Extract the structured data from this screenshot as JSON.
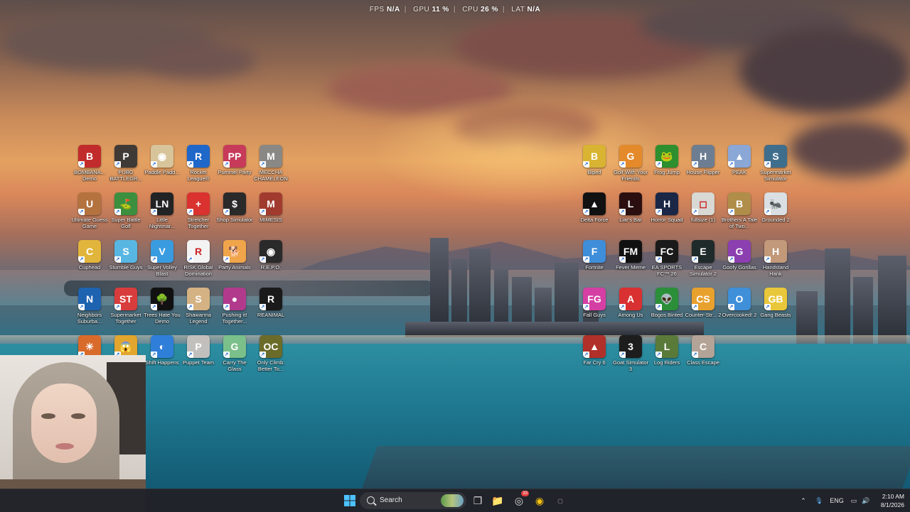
{
  "overlay": {
    "fps_label": "FPS",
    "fps_value": "N/A",
    "gpu_label": "GPU",
    "gpu_value": "11 %",
    "cpu_label": "CPU",
    "cpu_value": "26 %",
    "lat_label": "LAT",
    "lat_value": "N/A"
  },
  "desktop_left": [
    {
      "label": "BOMBANA... Demo",
      "icon": "bombana-icon",
      "color": "#c22b2b",
      "glyph": "B"
    },
    {
      "label": "PUBG BATTLEGR...",
      "icon": "pubg-icon",
      "color": "#3f3a35",
      "glyph": "P"
    },
    {
      "label": "Paddle Padd...",
      "icon": "paddle-icon",
      "color": "#d8c49a",
      "glyph": "◉"
    },
    {
      "label": "Rocket League®",
      "icon": "rocket-league-icon",
      "color": "#1f67c9",
      "glyph": "R"
    },
    {
      "label": "Pummel Party",
      "icon": "pummel-party-icon",
      "color": "#c73a59",
      "glyph": "PP"
    },
    {
      "label": "MECCHA CHAMELEON",
      "icon": "meccha-chameleon-icon",
      "color": "#8a8884",
      "glyph": "M"
    },
    {
      "label": "Ultimate Guess Game",
      "icon": "ultimate-guess-icon",
      "color": "#b3723e",
      "glyph": "U"
    },
    {
      "label": "Super Battle Golf",
      "icon": "super-battle-golf-icon",
      "color": "#3c8f3f",
      "glyph": "⛳"
    },
    {
      "label": "Little Nightmar...",
      "icon": "little-nightmares-icon",
      "color": "#222325",
      "glyph": "LN"
    },
    {
      "label": "Stretcher Together",
      "icon": "stretcher-icon",
      "color": "#d9322f",
      "glyph": "+"
    },
    {
      "label": "Shop Simulator",
      "icon": "shop-simulator-icon",
      "color": "#2a2a2a",
      "glyph": "$"
    },
    {
      "label": "MIMESIS",
      "icon": "mimesis-icon",
      "color": "#a13b2f",
      "glyph": "M"
    },
    {
      "label": "Cuphead",
      "icon": "cuphead-icon",
      "color": "#e1b53b",
      "glyph": "C"
    },
    {
      "label": "Stumble Guys",
      "icon": "stumble-guys-icon",
      "color": "#58b7e2",
      "glyph": "S"
    },
    {
      "label": "Super Volley Blast",
      "icon": "super-volley-icon",
      "color": "#3a9ce0",
      "glyph": "V"
    },
    {
      "label": "RISK Global Domination",
      "icon": "risk-icon",
      "color": "#f3f3f3",
      "glyph": "R"
    },
    {
      "label": "Party Animals",
      "icon": "party-animals-icon",
      "color": "#f0a54a",
      "glyph": "🐕"
    },
    {
      "label": "R.E.P.O.",
      "icon": "repo-icon",
      "color": "#2a2a2a",
      "glyph": "◉"
    },
    {
      "label": "Neighbors Suburba...",
      "icon": "neighbors-icon",
      "color": "#1e63b0",
      "glyph": "N"
    },
    {
      "label": "Supermarket Together",
      "icon": "supermarket-together-icon",
      "color": "#d93c3c",
      "glyph": "ST"
    },
    {
      "label": "Trees Hate You Demo",
      "icon": "trees-hate-you-icon",
      "color": "#111111",
      "glyph": "🌳"
    },
    {
      "label": "Shawarma Legend",
      "icon": "shawarma-legend-icon",
      "color": "#d5b283",
      "glyph": "S"
    },
    {
      "label": "Pushing it! Together...",
      "icon": "pushing-it-icon",
      "color": "#b13a8d",
      "glyph": "●"
    },
    {
      "label": "REANIMAL",
      "icon": "reanimal-icon",
      "color": "#1a1a1a",
      "glyph": "R"
    },
    {
      "label": "",
      "icon": "sun-game-icon",
      "color": "#d86a2a",
      "glyph": "☀"
    },
    {
      "label": "",
      "icon": "scream-face-icon",
      "color": "#e2a52e",
      "glyph": "😱"
    },
    {
      "label": "Shift Happens",
      "icon": "shift-happens-icon",
      "color": "#2f7fd9",
      "glyph": "◐"
    },
    {
      "label": "Puppet Team",
      "icon": "puppet-team-icon",
      "color": "#c2c0bd",
      "glyph": "P"
    },
    {
      "label": "Carry The Glass",
      "icon": "carry-the-glass-icon",
      "color": "#7bbf8a",
      "glyph": "G"
    },
    {
      "label": "Only Climb: Better To...",
      "icon": "only-climb-icon",
      "color": "#6b6b2a",
      "glyph": "OC"
    }
  ],
  "desktop_right": [
    {
      "label": "Biped",
      "icon": "biped-icon",
      "color": "#d9b432",
      "glyph": "B"
    },
    {
      "label": "Golf With Your Friends",
      "icon": "golf-with-friends-icon",
      "color": "#e48a2a",
      "glyph": "G"
    },
    {
      "label": "Frog Jump",
      "icon": "frog-jump-icon",
      "color": "#2d8f2d",
      "glyph": "🐸"
    },
    {
      "label": "House Flipper",
      "icon": "house-flipper-icon",
      "color": "#6d7e93",
      "glyph": "H"
    },
    {
      "label": "PEAK",
      "icon": "peak-icon",
      "color": "#8aa7d6",
      "glyph": "▲"
    },
    {
      "label": "Supermarket Simulator",
      "icon": "supermarket-simulator-icon",
      "color": "#3f6e8d",
      "glyph": "S"
    },
    {
      "label": "Delta Force",
      "icon": "delta-force-icon",
      "color": "#111111",
      "glyph": "▲"
    },
    {
      "label": "Liar's Bar",
      "icon": "liars-bar-icon",
      "color": "#2b0f10",
      "glyph": "L"
    },
    {
      "label": "Horror Squad",
      "icon": "horror-squad-icon",
      "color": "#1b2746",
      "glyph": "H"
    },
    {
      "label": "fullsize (1)",
      "icon": "fullsize-icon",
      "color": "#d8d8d4",
      "glyph": "◻"
    },
    {
      "label": "Brothers A Tale of Two...",
      "icon": "brothers-icon",
      "color": "#b08e4a",
      "glyph": "B"
    },
    {
      "label": "Grounded 2",
      "icon": "grounded-icon",
      "color": "#d9dfe3",
      "glyph": "🐜"
    },
    {
      "label": "Fortnite",
      "icon": "fortnite-icon",
      "color": "#3f8ed9",
      "glyph": "F"
    },
    {
      "label": "Fever Meme",
      "icon": "fever-meme-icon",
      "color": "#111111",
      "glyph": "FM"
    },
    {
      "label": "EA SPORTS FC™ 26",
      "icon": "ea-fc-icon",
      "color": "#1a1a1a",
      "glyph": "FC"
    },
    {
      "label": "Escape Simulator 2",
      "icon": "escape-simulator-icon",
      "color": "#1f2a2a",
      "glyph": "E"
    },
    {
      "label": "Goofy Gorillas",
      "icon": "goofy-gorillas-icon",
      "color": "#8b3fb0",
      "glyph": "G"
    },
    {
      "label": "Handstand Hank",
      "icon": "handstand-hank-icon",
      "color": "#c29a7a",
      "glyph": "H"
    },
    {
      "label": "Fall Guys",
      "icon": "fall-guys-icon",
      "color": "#d53fa3",
      "glyph": "FG"
    },
    {
      "label": "Among Us",
      "icon": "among-us-icon",
      "color": "#d93131",
      "glyph": "A"
    },
    {
      "label": "Bogos Binted",
      "icon": "bogos-binted-icon",
      "color": "#2b8f3a",
      "glyph": "👽"
    },
    {
      "label": "Counter-Str... 2",
      "icon": "counter-strike-icon",
      "color": "#e9a12e",
      "glyph": "CS"
    },
    {
      "label": "Overcooked! 2",
      "icon": "overcooked-icon",
      "color": "#3f8fd9",
      "glyph": "O"
    },
    {
      "label": "Gang Beasts",
      "icon": "gang-beasts-icon",
      "color": "#e9c73a",
      "glyph": "GB"
    },
    {
      "label": "Far Cry 6",
      "icon": "far-cry-icon",
      "color": "#b1302a",
      "glyph": "▲"
    },
    {
      "label": "Goat Simulator 3",
      "icon": "goat-simulator-icon",
      "color": "#1d1d1d",
      "glyph": "3"
    },
    {
      "label": "Log Riders",
      "icon": "log-riders-icon",
      "color": "#5a7a3a",
      "glyph": "L"
    },
    {
      "label": "Class Escape",
      "icon": "class-escape-icon",
      "color": "#b4a397",
      "glyph": "C"
    }
  ],
  "taskbar": {
    "search_placeholder": "Search",
    "apps": [
      {
        "name": "task-view-icon",
        "glyph": "❐"
      },
      {
        "name": "file-explorer-icon",
        "glyph": "📁"
      },
      {
        "name": "discord-icon",
        "glyph": "◎",
        "badge": "33"
      },
      {
        "name": "chrome-icon",
        "glyph": "◉"
      },
      {
        "name": "record-app-icon",
        "glyph": "◌"
      }
    ],
    "language": "ENG",
    "time": "2:10 AM",
    "date": "8/1/2026"
  }
}
